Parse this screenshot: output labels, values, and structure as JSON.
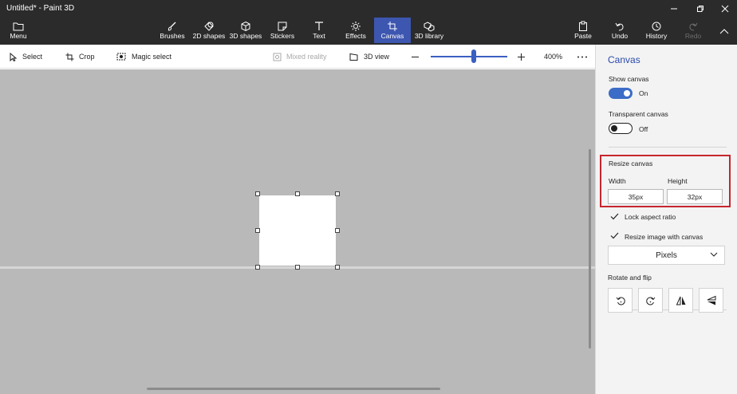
{
  "window": {
    "title": "Untitled* - Paint 3D"
  },
  "ribbon": {
    "menu": "Menu",
    "tools": [
      {
        "label": "Brushes",
        "icon": "brush-icon"
      },
      {
        "label": "2D shapes",
        "icon": "2d-shapes-icon"
      },
      {
        "label": "3D shapes",
        "icon": "3d-shapes-icon"
      },
      {
        "label": "Stickers",
        "icon": "stickers-icon"
      },
      {
        "label": "Text",
        "icon": "text-icon"
      },
      {
        "label": "Effects",
        "icon": "effects-icon"
      },
      {
        "label": "Canvas",
        "icon": "canvas-icon",
        "active": true
      },
      {
        "label": "3D library",
        "icon": "3d-library-icon"
      }
    ],
    "right": {
      "paste": "Paste",
      "undo": "Undo",
      "history": "History",
      "redo": "Redo"
    },
    "accent": "#3d56b0"
  },
  "toolbar": {
    "select": "Select",
    "crop": "Crop",
    "magic_select": "Magic select",
    "mixed_reality": "Mixed reality",
    "view_3d": "3D view",
    "zoom_level": "400%",
    "zoom_fraction": 0.56
  },
  "panel": {
    "title": "Canvas",
    "show_canvas": {
      "label": "Show canvas",
      "state": "On"
    },
    "transparent_canvas": {
      "label": "Transparent canvas",
      "state": "Off"
    },
    "resize": {
      "label": "Resize canvas",
      "width_label": "Width",
      "height_label": "Height",
      "width_value": "35px",
      "height_value": "32px"
    },
    "lock_aspect": "Lock aspect ratio",
    "resize_image": "Resize image with canvas",
    "units": "Pixels",
    "rotate_flip": "Rotate and flip"
  },
  "colors": {
    "highlight": "#c6262e",
    "toggle_on": "#3b6cc7",
    "workspace": "#b9b9b9"
  }
}
